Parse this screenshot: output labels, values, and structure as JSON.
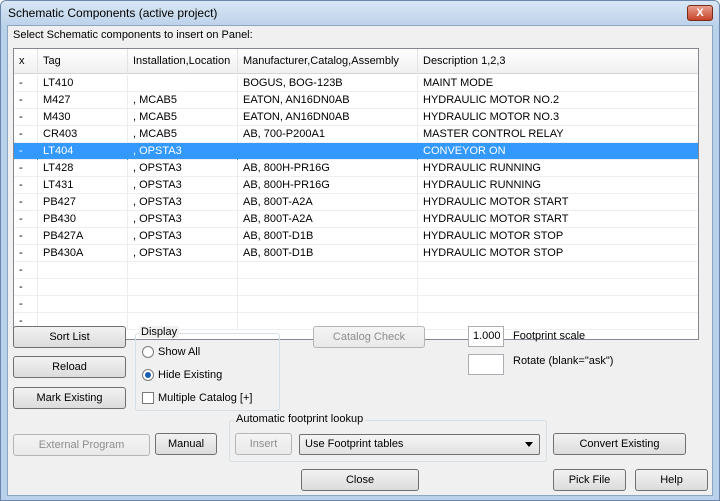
{
  "window": {
    "title": "Schematic Components (active project)",
    "close_glyph": "X"
  },
  "prompt": "Select Schematic components to insert on Panel:",
  "table": {
    "columns": [
      "x",
      "Tag",
      "Installation,Location",
      "Manufacturer,Catalog,Assembly",
      "Description 1,2,3"
    ],
    "rows": [
      [
        "-",
        "LT410",
        "",
        "BOGUS, BOG-123B",
        "MAINT MODE"
      ],
      [
        "-",
        "M427",
        ", MCAB5",
        "EATON, AN16DN0AB",
        "HYDRAULIC MOTOR NO.2"
      ],
      [
        "-",
        "M430",
        ", MCAB5",
        "EATON, AN16DN0AB",
        "HYDRAULIC MOTOR NO.3"
      ],
      [
        "-",
        "CR403",
        ", MCAB5",
        "AB, 700-P200A1",
        "MASTER CONTROL RELAY"
      ],
      [
        "-",
        "LT404",
        ", OPSTA3",
        "",
        "CONVEYOR ON"
      ],
      [
        "-",
        "LT428",
        ", OPSTA3",
        "AB, 800H-PR16G",
        "HYDRAULIC RUNNING"
      ],
      [
        "-",
        "LT431",
        ", OPSTA3",
        "AB, 800H-PR16G",
        "HYDRAULIC RUNNING"
      ],
      [
        "-",
        "PB427",
        ", OPSTA3",
        "AB, 800T-A2A",
        "HYDRAULIC MOTOR START"
      ],
      [
        "-",
        "PB430",
        ", OPSTA3",
        "AB, 800T-A2A",
        "HYDRAULIC MOTOR START"
      ],
      [
        "-",
        "PB427A",
        ", OPSTA3",
        "AB, 800T-D1B",
        "HYDRAULIC MOTOR STOP"
      ],
      [
        "-",
        "PB430A",
        ", OPSTA3",
        "AB, 800T-D1B",
        "HYDRAULIC MOTOR STOP"
      ],
      [
        "-",
        "",
        "",
        "",
        ""
      ],
      [
        "-",
        "",
        "",
        "",
        ""
      ],
      [
        "-",
        "",
        "",
        "",
        ""
      ],
      [
        "-",
        "",
        "",
        "",
        ""
      ]
    ],
    "selected_row": 4
  },
  "buttons": {
    "sort_list": "Sort List",
    "reload": "Reload",
    "mark_existing": "Mark Existing",
    "external_program": "External Program",
    "manual": "Manual",
    "catalog_check": "Catalog Check",
    "insert": "Insert",
    "convert_existing": "Convert Existing",
    "close": "Close",
    "pick_file": "Pick File",
    "help": "Help"
  },
  "display": {
    "label": "Display",
    "show_all": "Show All",
    "hide_existing": "Hide Existing",
    "multiple_catalog": "Multiple Catalog [+]",
    "selected": "hide_existing",
    "multiple_catalog_checked": false
  },
  "footprint": {
    "scale_value": "1.000",
    "scale_label": "Footprint scale",
    "rotate_value": "",
    "rotate_label": "Rotate (blank=\"ask\")",
    "lookup_label": "Automatic footprint lookup",
    "lookup_selected": "Use Footprint tables"
  },
  "colors": {
    "selection": "#3399ff",
    "window_frame": "#b9d1ea",
    "dialog_bg": "#f0f0f0"
  }
}
